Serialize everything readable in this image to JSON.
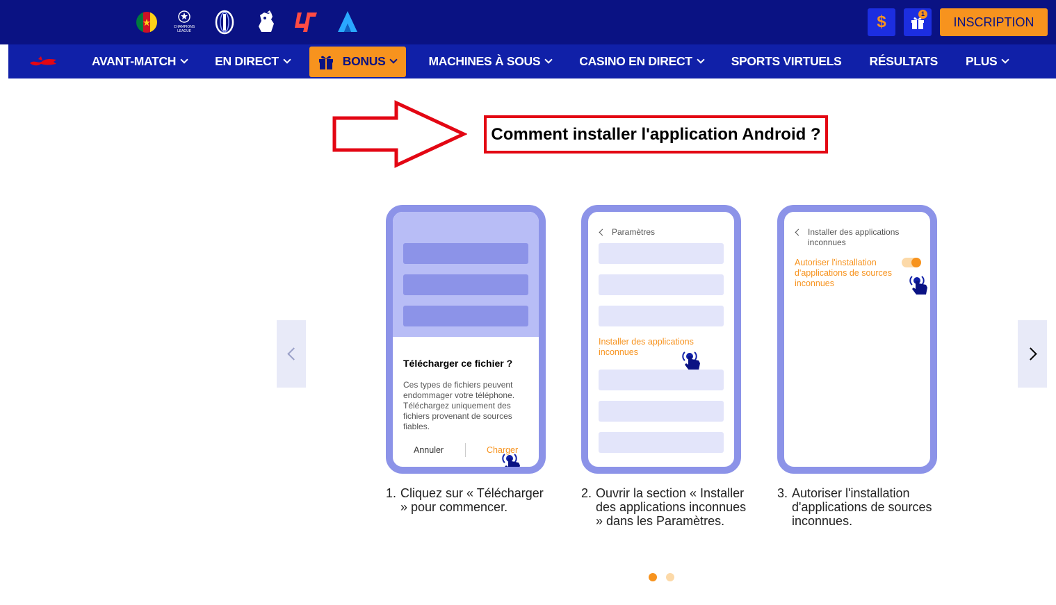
{
  "header": {
    "leagues": [
      {
        "name": "cameroon-flag-icon"
      },
      {
        "name": "champions-league-icon",
        "label": "CHAMPIONS LEAGUE"
      },
      {
        "name": "europa-league-icon"
      },
      {
        "name": "premier-league-icon"
      },
      {
        "name": "laliga-icon"
      },
      {
        "name": "serie-a-icon"
      }
    ],
    "balance_icon": "$",
    "gift_badge": "1",
    "signup_label": "INSCRIPTION"
  },
  "nav": {
    "items": [
      "AVANT-MATCH",
      "EN DIRECT",
      "BONUS",
      "MACHINES À SOUS",
      "CASINO EN DIRECT",
      "SPORTS VIRTUELS",
      "RÉSULTATS",
      "PLUS"
    ]
  },
  "title": "Comment installer l'application Android ?",
  "steps": [
    {
      "dialog_title": "Télécharger ce fichier ?",
      "dialog_body": "Ces types de fichiers peuvent endommager votre téléphone. Téléchargez uniquement des fichiers provenant de sources fiables.",
      "cancel": "Annuler",
      "confirm": "Charger",
      "number": "1.",
      "caption": "Cliquez sur « Télécharger » pour commencer."
    },
    {
      "back_label": "Paramètres",
      "highlight": "Installer des applications inconnues",
      "number": "2.",
      "caption": "Ouvrir la section « Installer des applications inconnues » dans les Paramètres."
    },
    {
      "back_label": "Installer des applications inconnues",
      "highlight": "Autoriser l'installation d'applications de sources inconnues",
      "number": "3.",
      "caption": "Autoriser l'installation d'applications de sources inconnues."
    }
  ],
  "pagination": {
    "total": 2,
    "active": 1
  },
  "colors": {
    "top": "#0a1283",
    "nav": "#1020a8",
    "accent": "#f7931e",
    "phone": "#8c93e8",
    "annotation": "#e30613"
  }
}
